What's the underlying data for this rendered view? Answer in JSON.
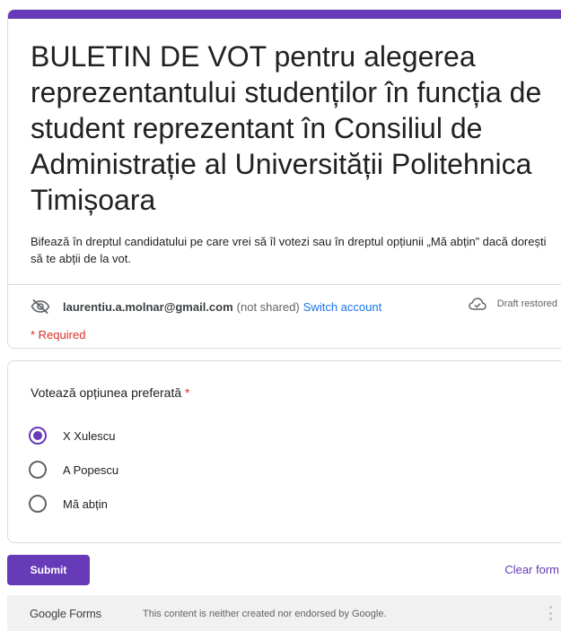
{
  "form": {
    "title": "BULETIN DE VOT pentru alegerea reprezentantului studenților în funcția de student reprezentant în Consiliul de Administrație al Universității Politehnica Timișoara",
    "description": "Bifează în dreptul candidatului pe care vrei să îl votezi sau în dreptul opțiunii „Mă abțin” dacă dorești să te abții de la vot.",
    "accent_color": "#673ab7"
  },
  "account": {
    "email": "laurentiu.a.molnar@gmail.com",
    "not_shared": "(not shared)",
    "switch_label": "Switch account",
    "draft_status": "Draft restored",
    "visibility_icon": "eye-off-icon",
    "cloud_icon": "cloud-check-icon"
  },
  "required_note": "* Required",
  "question": {
    "title": "Votează opțiunea preferată",
    "required_marker": "*",
    "options": [
      {
        "label": "X Xulescu",
        "selected": true
      },
      {
        "label": "A Popescu",
        "selected": false
      },
      {
        "label": "Mă abțin",
        "selected": false
      }
    ]
  },
  "actions": {
    "submit_label": "Submit",
    "clear_label": "Clear form"
  },
  "footer": {
    "logo": "Google Forms",
    "disclaimer": "This content is neither created nor endorsed by Google.",
    "more_icon": "more-vert-icon"
  }
}
